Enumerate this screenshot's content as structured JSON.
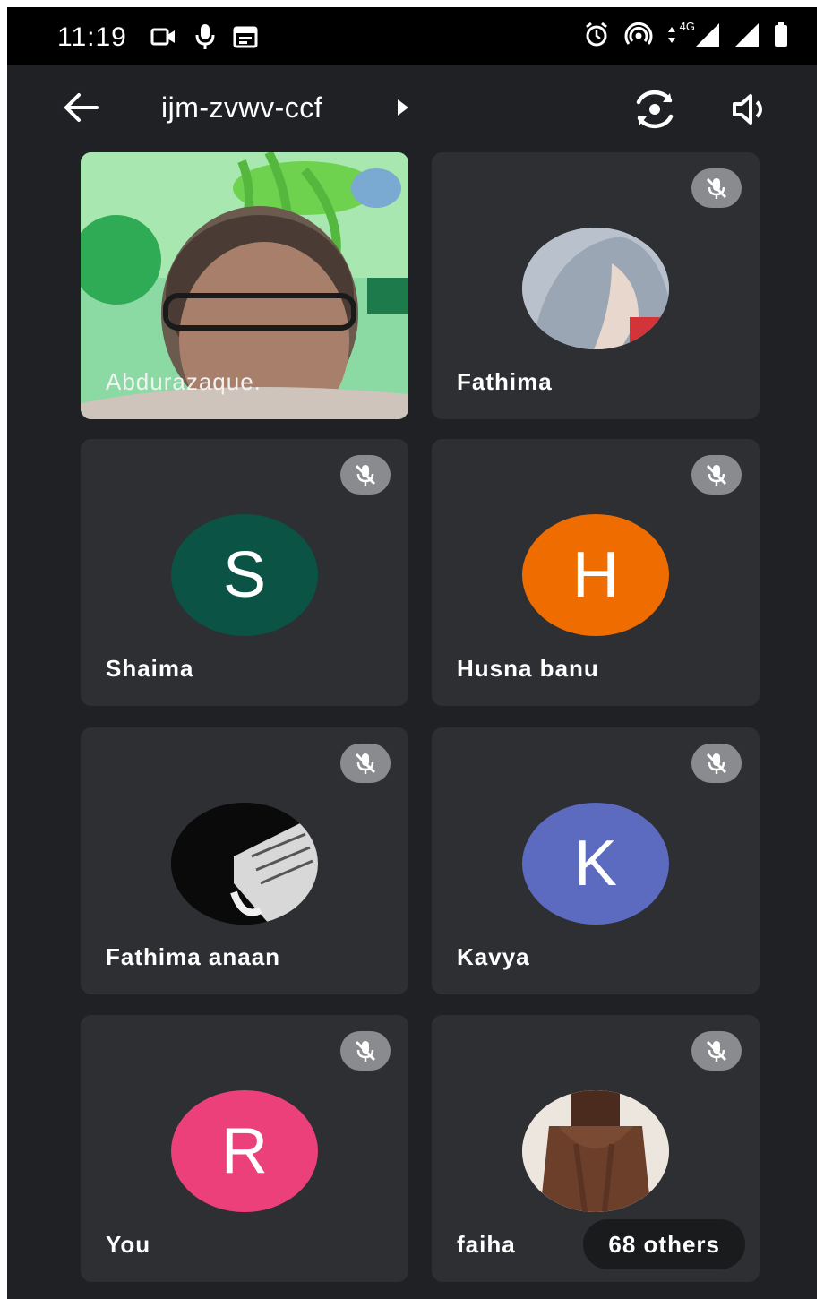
{
  "status_bar": {
    "time": "11:19",
    "network": "4G",
    "icons_left": [
      "video-icon",
      "mic-icon",
      "calendar-icon"
    ],
    "icons_right": [
      "alarm-icon",
      "hotspot-icon",
      "data-arrows-icon",
      "signal-icon",
      "signal-icon",
      "battery-icon"
    ]
  },
  "header": {
    "meeting_code": "ijm-zvwv-ccf",
    "icons": [
      "back-arrow-icon",
      "caret-right-icon",
      "switch-camera-icon",
      "speaker-icon"
    ]
  },
  "participants": [
    {
      "name": "Abdurazaque.",
      "type": "video",
      "muted": false
    },
    {
      "name": "Fathima",
      "type": "photo",
      "muted": true
    },
    {
      "name": "Shaima",
      "type": "initial",
      "initial": "S",
      "color": "#0b5345",
      "muted": true
    },
    {
      "name": "Husna banu",
      "type": "initial",
      "initial": "H",
      "color": "#ef6c00",
      "muted": true
    },
    {
      "name": "Fathima anaan",
      "type": "photo",
      "muted": true
    },
    {
      "name": "Kavya",
      "type": "initial",
      "initial": "K",
      "color": "#5c6bc0",
      "muted": true
    },
    {
      "name": "You",
      "type": "initial",
      "initial": "R",
      "color": "#ec407a",
      "muted": true
    },
    {
      "name": "faiha",
      "type": "photo",
      "muted": true
    }
  ],
  "others_badge": "68 others",
  "colors": {
    "background": "#202124",
    "tile": "#2e2f33",
    "mute_pill": "#8a8b8e"
  }
}
